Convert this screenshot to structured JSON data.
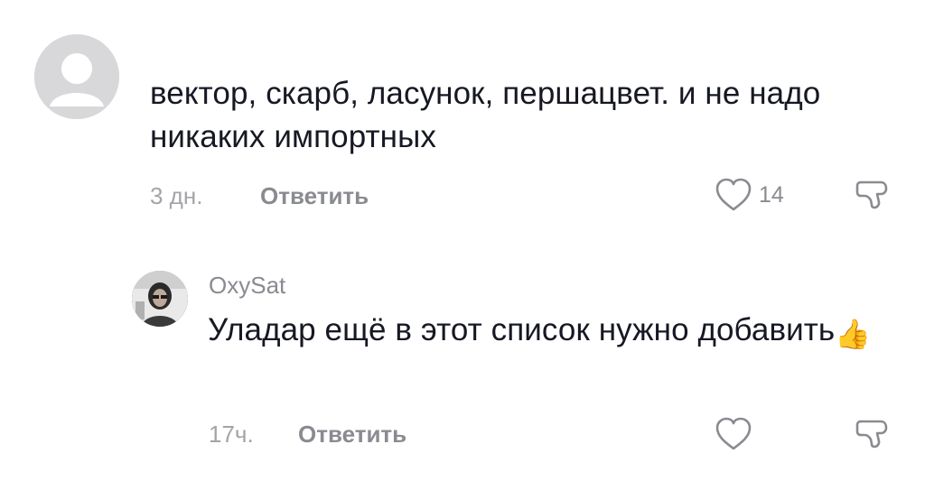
{
  "comments": [
    {
      "username": "",
      "text": "вектор, скарб, ласунок, першацвет. и не надо никаких импортных",
      "time": "3 дн.",
      "reply_label": "Ответить",
      "likes": "14"
    },
    {
      "username": "OxySat",
      "text": "Уладар ещё в этот список нужно добавить",
      "emoji": "👍",
      "time": "17ч.",
      "reply_label": "Ответить",
      "likes": ""
    }
  ],
  "icons": {
    "like": "heart-outline-icon",
    "dislike": "thumbs-down-outline-icon"
  },
  "colors": {
    "text": "#161823",
    "secondary": "#8a8b91",
    "avatar_placeholder": "#d8d8da"
  }
}
